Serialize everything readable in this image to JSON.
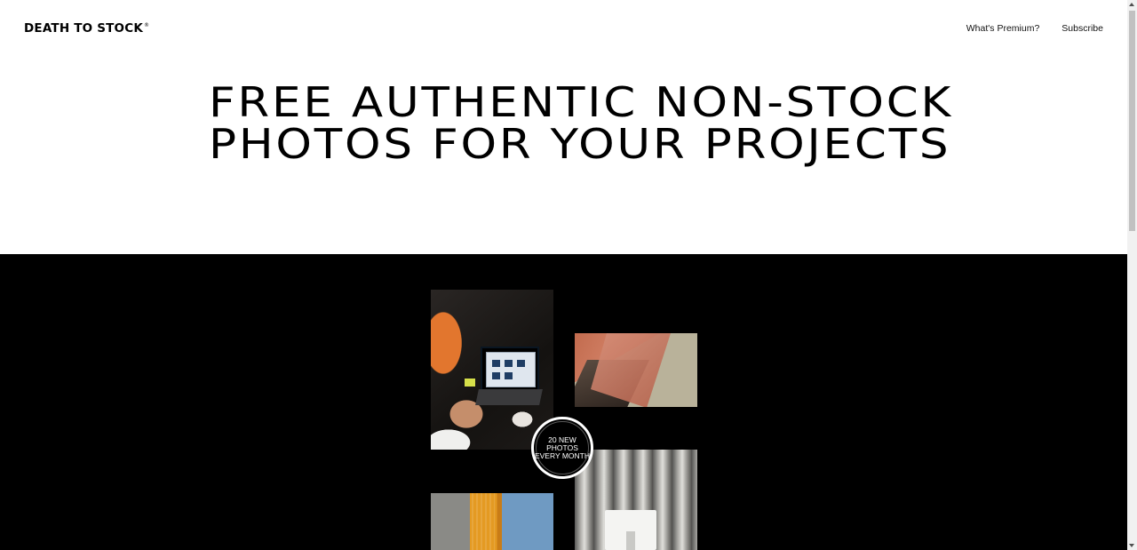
{
  "header": {
    "logo_text": "DEATH TO STOCK",
    "logo_mark": "®",
    "nav": [
      {
        "label": "What's Premium?"
      },
      {
        "label": "Subscribe"
      }
    ]
  },
  "hero": {
    "title": "FREE AUTHENTIC NON-STOCK PHOTOS FOR YOUR PROJECTS"
  },
  "gallery": {
    "badge_text": "20 NEW\nPHOTOS\nEVERY MONTH"
  },
  "colors": {
    "background": "#ffffff",
    "dark_section": "#000000",
    "text": "#000000"
  }
}
